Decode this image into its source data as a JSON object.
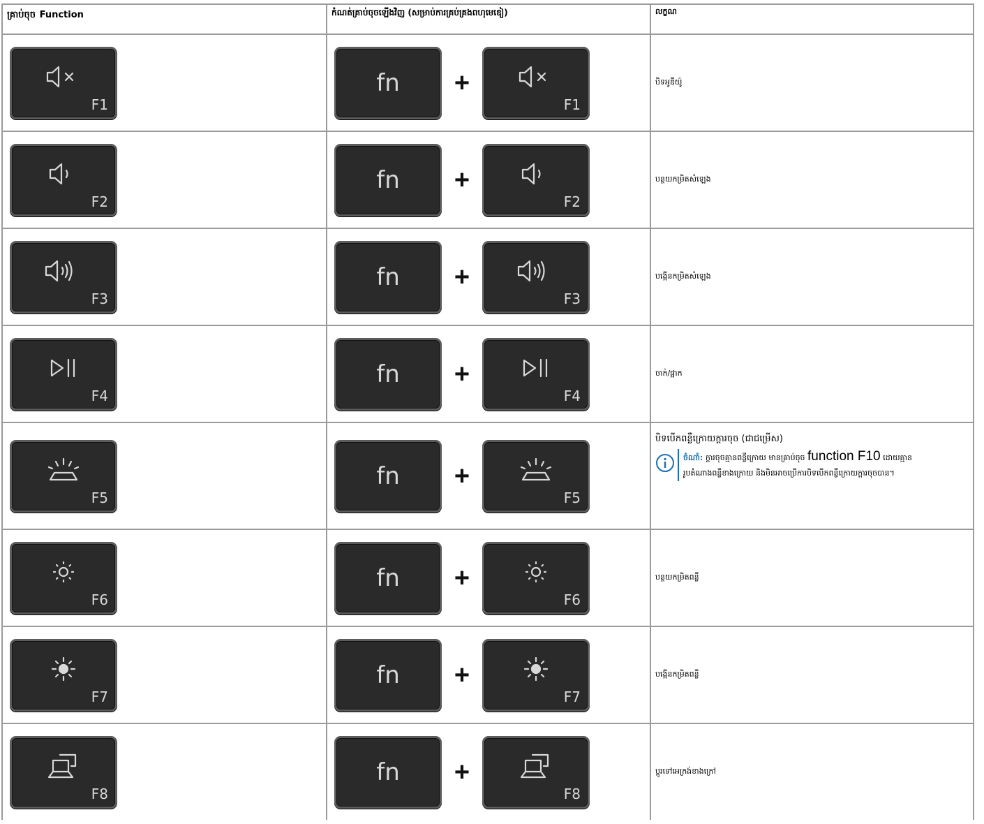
{
  "headers": {
    "col1_prefix": "គ្រាប់ចុច",
    "col1_bold": "Function",
    "col2": "កំណត់គ្រាប់ចុចឡើងវិញ (សម្រាប់ការគ្រប់គ្រងពហុមេឌៀ)",
    "col3": "លក្ខណ"
  },
  "combo": {
    "fn_label": "fn",
    "plus": "+"
  },
  "rows": [
    {
      "key": "F1",
      "icon": "mute-icon",
      "desc": "បិទអូឌីយ៉ូ"
    },
    {
      "key": "F2",
      "icon": "volume-down-icon",
      "desc": "បន្ថយកម្រិតសំឡេង"
    },
    {
      "key": "F3",
      "icon": "volume-up-icon",
      "desc": "បង្កើនកម្រិតសំឡេង"
    },
    {
      "key": "F4",
      "icon": "play-pause-icon",
      "desc": "ចាក់/ផ្អាក"
    },
    {
      "key": "F5",
      "icon": "keyboard-backlight-icon",
      "desc": "បិទបើកពន្លឺក្រោយក្តារចុច (ជាជម្រើស)",
      "note": {
        "label": "ចំណាំ:",
        "text_a": "ក្តារចុចគ្មានពន្លឺក្រោយ មានគ្រាប់ចុច",
        "text_big": "function F10",
        "text_b": "ដោយគ្មាន",
        "text_c": "រូបតំណាងពន្លឺខាងក្រោយ និងមិនអាចប្រើការបិទបើកពន្លឺក្រោយក្តារចុចបាន។"
      }
    },
    {
      "key": "F6",
      "icon": "brightness-down-icon",
      "desc": "បន្ថយកម្រិតពន្លឺ"
    },
    {
      "key": "F7",
      "icon": "brightness-up-icon",
      "desc": "បង្កើនកម្រិតពន្លឺ"
    },
    {
      "key": "F8",
      "icon": "external-display-icon",
      "desc": "ប្តូរទៅអេក្រង់ខាងក្រៅ"
    }
  ]
}
